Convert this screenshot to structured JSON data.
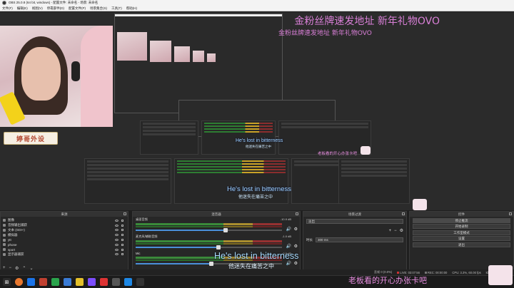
{
  "window": {
    "title": "OBS 25.0.8 (64 bit, windows) - 配置文件: 未命名 - 场景: 未命名"
  },
  "menu": [
    "文件(F)",
    "编辑(E)",
    "视图(V)",
    "停靠部件(D)",
    "配置文件(P)",
    "场景集合(S)",
    "工具(T)",
    "帮助(H)"
  ],
  "overlay": {
    "banner": "金粉丝牌速发地址 新年礼物OVO",
    "nameplate": "婷哥外设",
    "subtitle_en": "He's lost in bitterness",
    "subtitle_zh": "他迷失在痛苦之中",
    "pink_note": "老板看的开心办张卡吧"
  },
  "docks": {
    "scenes_title": "来源",
    "mixer_title": "混音器",
    "transitions_title": "场景过渡",
    "controls_title": "控件"
  },
  "sources": [
    {
      "name": "图像"
    },
    {
      "name": "音频输出捕获"
    },
    {
      "name": "文本 (GDI+)"
    },
    {
      "name": "模拟器"
    },
    {
      "name": "ytt"
    },
    {
      "name": "phone"
    },
    {
      "name": "sport"
    },
    {
      "name": "显示器捕获"
    }
  ],
  "mixer": [
    {
      "name": "桌面音频",
      "db": "-10.9 dB",
      "fill": 0.6
    },
    {
      "name": "麦克风/辅助音频",
      "db": "-1.0 dB",
      "fill": 0.55
    },
    {
      "name": "Mic",
      "db": "0.0 dB",
      "fill": 0.5
    }
  ],
  "transitions": {
    "type": "淡出",
    "duration_label": "时长",
    "duration": "300 ms"
  },
  "controls": [
    {
      "label": "停止推流",
      "active": true
    },
    {
      "label": "开始录制",
      "active": false
    },
    {
      "label": "工作室模式",
      "active": false
    },
    {
      "label": "设置",
      "active": false
    },
    {
      "label": "退出",
      "active": false
    }
  ],
  "status": {
    "dropped": "丢帧 0 (0.0%)",
    "live": "LIVE: 03:07:56",
    "rec": "REC: 00:00:00",
    "cpu": "CPU: 3.3%, 60.00 fps",
    "kbps": "kb/s: 1345"
  }
}
